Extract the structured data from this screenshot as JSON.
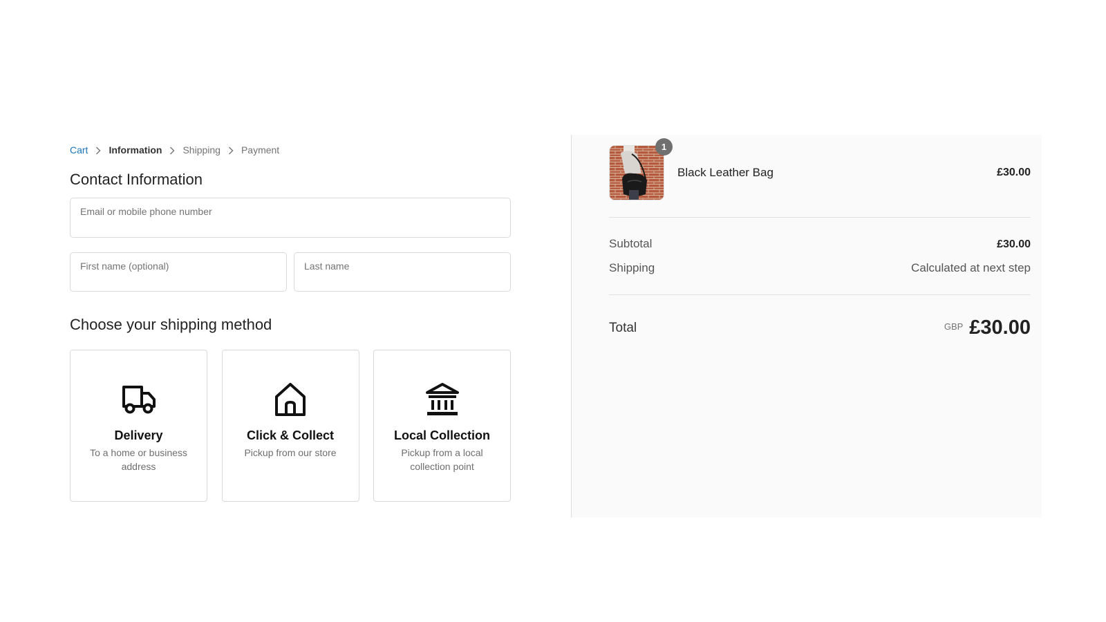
{
  "breadcrumb": {
    "items": [
      {
        "label": "Cart",
        "state": "link"
      },
      {
        "label": "Information",
        "state": "current"
      },
      {
        "label": "Shipping",
        "state": "upcoming"
      },
      {
        "label": "Payment",
        "state": "upcoming"
      }
    ]
  },
  "contact": {
    "title": "Contact Information",
    "email_placeholder": "Email or mobile phone number",
    "first_name_placeholder": "First name (optional)",
    "last_name_placeholder": "Last name"
  },
  "shipping": {
    "title": "Choose your shipping method",
    "options": [
      {
        "name": "Delivery",
        "description": "To a home or business address",
        "icon": "truck-icon"
      },
      {
        "name": "Click & Collect",
        "description": "Pickup from our store",
        "icon": "home-icon"
      },
      {
        "name": "Local Collection",
        "description": "Pickup from a local collection point",
        "icon": "building-icon"
      }
    ]
  },
  "summary": {
    "product": {
      "name": "Black Leather Bag",
      "price": "£30.00",
      "quantity": "1",
      "image": "product-thumbnail"
    },
    "subtotal_label": "Subtotal",
    "subtotal_value": "£30.00",
    "shipping_label": "Shipping",
    "shipping_value": "Calculated at next step",
    "total_label": "Total",
    "total_currency": "GBP",
    "total_value": "£30.00"
  },
  "colors": {
    "link": "#1a73b8",
    "summary_bg": "#fafafa",
    "border": "#d9d9d9",
    "badge": "#707070"
  }
}
